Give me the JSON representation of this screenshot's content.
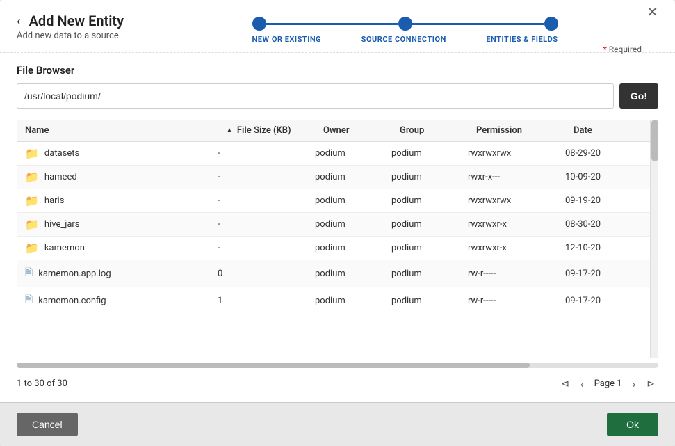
{
  "modal": {
    "title": "Add New Entity",
    "subtitle": "Add new data to a source.",
    "back_icon": "‹",
    "close_icon": "✕",
    "required_label": "* Required"
  },
  "stepper": {
    "steps": [
      {
        "label": "NEW OR EXISTING"
      },
      {
        "label": "SOURCE CONNECTION"
      },
      {
        "label": "ENTITIES & FIELDS"
      }
    ]
  },
  "file_browser": {
    "section_title": "File Browser",
    "path_value": "/usr/local/podium/",
    "go_label": "Go!"
  },
  "table": {
    "columns": [
      {
        "label": "Name",
        "sortable": true
      },
      {
        "label": "File Size (KB)",
        "sortable": true
      },
      {
        "label": "Owner",
        "sortable": false
      },
      {
        "label": "Group",
        "sortable": false
      },
      {
        "label": "Permission",
        "sortable": false
      },
      {
        "label": "Date",
        "sortable": false
      }
    ],
    "rows": [
      {
        "type": "folder",
        "name": "datasets",
        "size": "-",
        "owner": "podium",
        "group": "podium",
        "permission": "rwxrwxrwx",
        "date": "08-29-20"
      },
      {
        "type": "folder",
        "name": "hameed",
        "size": "-",
        "owner": "podium",
        "group": "podium",
        "permission": "rwxr-x---",
        "date": "10-09-20"
      },
      {
        "type": "folder",
        "name": "haris",
        "size": "-",
        "owner": "podium",
        "group": "podium",
        "permission": "rwxrwxrwx",
        "date": "09-19-20"
      },
      {
        "type": "folder",
        "name": "hive_jars",
        "size": "-",
        "owner": "podium",
        "group": "podium",
        "permission": "rwxrwxr-x",
        "date": "08-30-20"
      },
      {
        "type": "folder",
        "name": "kamemon",
        "size": "-",
        "owner": "podium",
        "group": "podium",
        "permission": "rwxrwxr-x",
        "date": "12-10-20"
      },
      {
        "type": "file",
        "name": "kamemon.app.log",
        "size": "0",
        "owner": "podium",
        "group": "podium",
        "permission": "rw-r-----",
        "date": "09-17-20"
      },
      {
        "type": "file",
        "name": "kamemon.config",
        "size": "1",
        "owner": "podium",
        "group": "podium",
        "permission": "rw-r-----",
        "date": "09-17-20"
      }
    ]
  },
  "pagination": {
    "info": "1 to 30 of 30",
    "page_label": "Page 1",
    "first_icon": "⊲",
    "prev_icon": "‹",
    "next_icon": "›",
    "last_icon": "⊳"
  },
  "footer": {
    "cancel_label": "Cancel",
    "ok_label": "Ok"
  }
}
